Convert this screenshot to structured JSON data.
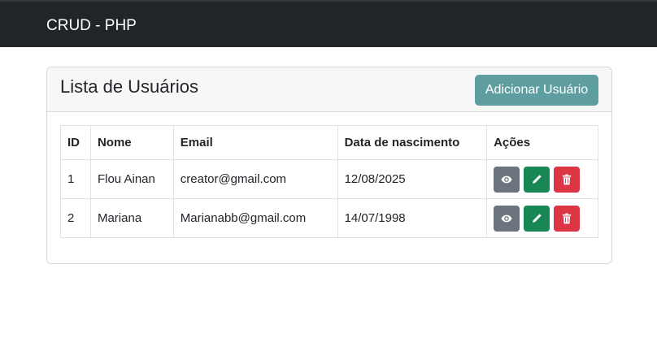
{
  "navbar": {
    "brand": "CRUD - PHP"
  },
  "card": {
    "title": "Lista de Usuários",
    "add_button_label": "Adicionar Usuário"
  },
  "table": {
    "headers": [
      "ID",
      "Nome",
      "Email",
      "Data de nascimento",
      "Ações"
    ],
    "rows": [
      {
        "id": "1",
        "nome": "Flou Ainan",
        "email": "creator@gmail.com",
        "data": "12/08/2025"
      },
      {
        "id": "2",
        "nome": "Mariana",
        "email": "Marianabb@gmail.com",
        "data": "14/07/1998"
      }
    ]
  },
  "colors": {
    "navbar_bg": "#212529",
    "add_button": "#5f9ea0",
    "view_button": "#6c757d",
    "edit_button": "#198754",
    "delete_button": "#dc3545"
  },
  "icons": {
    "view": "eye-icon",
    "edit": "pencil-icon",
    "delete": "trash-icon"
  }
}
